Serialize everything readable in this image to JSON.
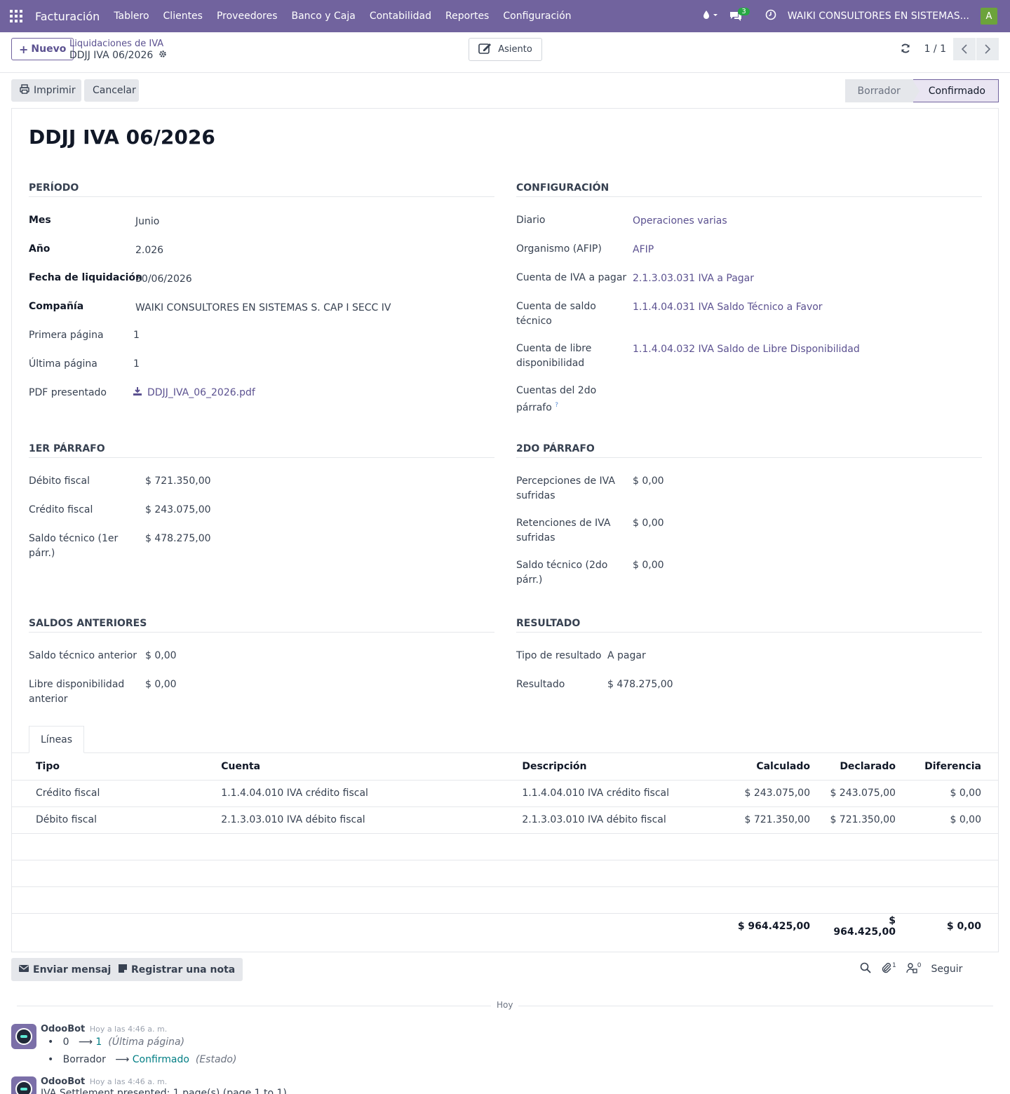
{
  "navbar": {
    "brand": "Facturación",
    "menu": [
      "Tablero",
      "Clientes",
      "Proveedores",
      "Banco y Caja",
      "Contabilidad",
      "Reportes",
      "Configuración"
    ],
    "messages_badge": "3",
    "company": "WAIKI CONSULTORES EN SISTEMAS...",
    "user_initial": "A"
  },
  "control": {
    "new_label": "Nuevo",
    "breadcrumb_parent": "Liquidaciones de IVA",
    "breadcrumb_current": "DDJJ IVA 06/2026",
    "asiento_label": "Asiento",
    "pager": "1 / 1"
  },
  "statusbar": {
    "print_label": "Imprimir",
    "cancel_label": "Cancelar",
    "stages": [
      "Borrador",
      "Confirmado"
    ],
    "active_stage": "Confirmado"
  },
  "form": {
    "title": "DDJJ IVA 06/2026",
    "periodo": {
      "title": "PERÍODO",
      "mes_label": "Mes",
      "mes": "Junio",
      "anio_label": "Año",
      "anio": "2.026",
      "fecha_label": "Fecha de liquidación",
      "fecha": "30/06/2026",
      "compania_label": "Compañía",
      "compania": "WAIKI CONSULTORES EN SISTEMAS S. CAP I SECC IV",
      "primera_label": "Primera página",
      "primera": "1",
      "ultima_label": "Última página",
      "ultima": "1",
      "pdf_label": "PDF presentado",
      "pdf": "DDJJ_IVA_06_2026.pdf"
    },
    "configuracion": {
      "title": "CONFIGURACIÓN",
      "diario_label": "Diario",
      "diario": "Operaciones varias",
      "organismo_label": "Organismo (AFIP)",
      "organismo": "AFIP",
      "cuenta_pagar_label": "Cuenta de IVA a pagar",
      "cuenta_pagar": "2.1.3.03.031 IVA a Pagar",
      "cuenta_saldo_label_1": "Cuenta de saldo",
      "cuenta_saldo_label_2": "técnico",
      "cuenta_saldo": "1.1.4.04.031 IVA Saldo Técnico a Favor",
      "cuenta_libre_label_1": "Cuenta de libre",
      "cuenta_libre_label_2": "disponibilidad",
      "cuenta_libre": "1.1.4.04.032 IVA Saldo de Libre Disponibilidad",
      "cuentas_2do_label_1": "Cuentas del 2do",
      "cuentas_2do_label_2": "párrafo",
      "help_mark": "?"
    },
    "parrafo1": {
      "title": "1ER PÁRRAFO",
      "debito_label": "Débito fiscal",
      "debito": "$ 721.350,00",
      "credito_label": "Crédito fiscal",
      "credito": "$ 243.075,00",
      "saldo_label_1": "Saldo técnico (1er",
      "saldo_label_2": "párr.)",
      "saldo": "$ 478.275,00"
    },
    "parrafo2": {
      "title": "2DO PÁRRAFO",
      "percepciones_label_1": "Percepciones de IVA",
      "percepciones_label_2": "sufridas",
      "percepciones": "$ 0,00",
      "retenciones_label_1": "Retenciones de IVA",
      "retenciones_label_2": "sufridas",
      "retenciones": "$ 0,00",
      "saldo_label_1": "Saldo técnico (2do",
      "saldo_label_2": "párr.)",
      "saldo": "$ 0,00"
    },
    "saldos": {
      "title": "SALDOS ANTERIORES",
      "saldo_label": "Saldo técnico anterior",
      "saldo": "$ 0,00",
      "libre_label_1": "Libre disponibilidad",
      "libre_label_2": "anterior",
      "libre": "$ 0,00"
    },
    "resultado": {
      "title": "RESULTADO",
      "tipo_label": "Tipo de resultado",
      "tipo": "A pagar",
      "resultado_label": "Resultado",
      "resultado": "$ 478.275,00"
    }
  },
  "lines": {
    "tab_label": "Líneas",
    "columns": [
      "Tipo",
      "Cuenta",
      "Descripción",
      "Calculado",
      "Declarado",
      "Diferencia"
    ],
    "rows": [
      [
        "Crédito fiscal",
        "1.1.4.04.010 IVA crédito fiscal",
        "1.1.4.04.010 IVA crédito fiscal",
        "$ 243.075,00",
        "$ 243.075,00",
        "$ 0,00"
      ],
      [
        "Débito fiscal",
        "2.1.3.03.010 IVA débito fiscal",
        "2.1.3.03.010 IVA débito fiscal",
        "$ 721.350,00",
        "$ 721.350,00",
        "$ 0,00"
      ]
    ],
    "totals": [
      "$ 964.425,00",
      "$ 964.425,00",
      "$ 0,00"
    ]
  },
  "chatter": {
    "send_label": "Enviar mensaje",
    "note_label": "Registrar una nota",
    "attachments_count": "1",
    "followers_count": "0",
    "follow_label": "Seguir",
    "day_label": "Hoy",
    "messages": [
      {
        "author": "OdooBot",
        "time": "Hoy a las 4:46 a. m.",
        "changes": [
          {
            "old": "0",
            "new": "1",
            "field": "(Última página)"
          },
          {
            "old": "Borrador",
            "new": "Confirmado",
            "field": "(Estado)"
          }
        ]
      },
      {
        "author": "OdooBot",
        "time": "Hoy a las 4:46 a. m.",
        "body": "IVA Settlement presented: 1 page(s) (page 1 to 1)"
      }
    ]
  }
}
